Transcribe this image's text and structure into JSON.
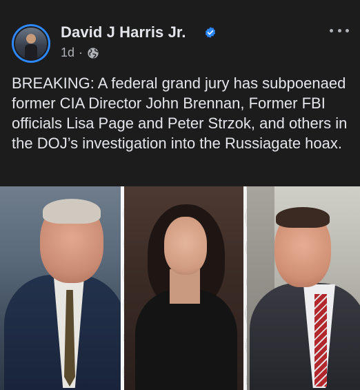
{
  "post": {
    "author_name": "David J Harris Jr.",
    "time_ago": "1d",
    "separator": "·",
    "audience_icon": "globe-icon",
    "verified_icon": "verified-badge-icon",
    "more_icon": "more-options-icon",
    "text": "BREAKING: A federal grand jury has subpoenaed former CIA Director John Brennan, Former FBI officials Lisa Page and Peter Strzok, and others in the DOJ’s investigation into the Russiagate hoax.",
    "image": {
      "panels": [
        "left-portrait",
        "center-portrait",
        "right-portrait"
      ]
    }
  },
  "colors": {
    "background": "#1c1c1d",
    "primary_text": "#e4e6eb",
    "secondary_text": "#b0b3b8",
    "verified_blue": "#2d88ff"
  }
}
